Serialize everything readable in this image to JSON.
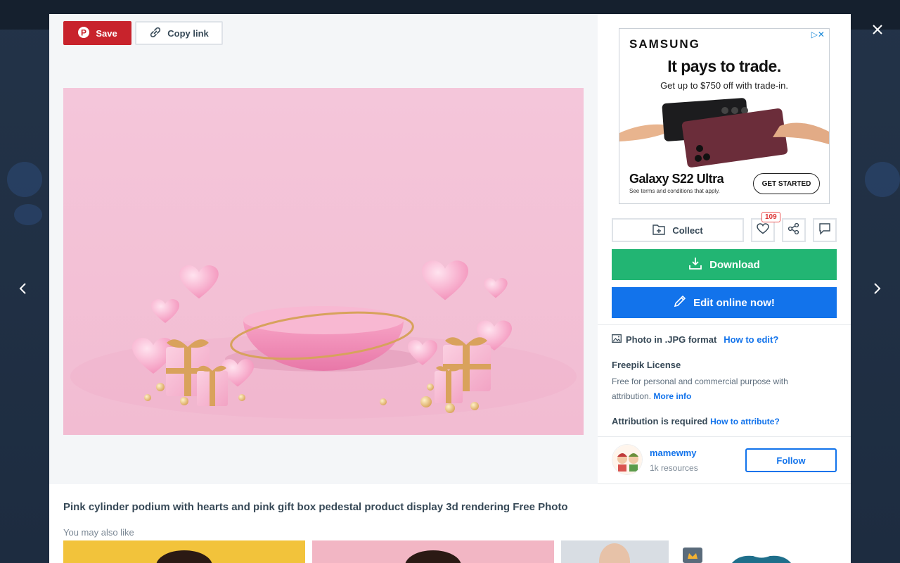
{
  "toolbar": {
    "save_label": "Save",
    "copy_link_label": "Copy link"
  },
  "ad": {
    "brand": "SAMSUNG",
    "headline": "It pays to trade.",
    "subline": "Get up to $750 off with trade-in.",
    "product": "Galaxy S22 Ultra",
    "terms": "See terms and conditions that apply.",
    "cta": "GET STARTED",
    "adchoices": "▷✕"
  },
  "actions": {
    "collect_label": "Collect",
    "like_count": "109",
    "download_label": "Download",
    "edit_label": "Edit online now!"
  },
  "file": {
    "format_text": "Photo in .JPG format",
    "how_to_edit": "How to edit?"
  },
  "license": {
    "title": "Freepik License",
    "text": "Free for personal and commercial purpose with attribution.",
    "more_info": "More info",
    "attribution_label": "Attribution is required",
    "how_to_attribute": "How to attribute?"
  },
  "author": {
    "name": "mamewmy",
    "resources": "1k resources",
    "follow_label": "Follow"
  },
  "photo": {
    "title": "Pink cylinder podium with hearts and pink gift box pedestal product display 3d rendering Free Photo"
  },
  "related": {
    "label": "You may also like"
  },
  "colors": {
    "save": "#c8232c",
    "download": "#22b573",
    "edit": "#1273eb",
    "link": "#1273eb"
  }
}
